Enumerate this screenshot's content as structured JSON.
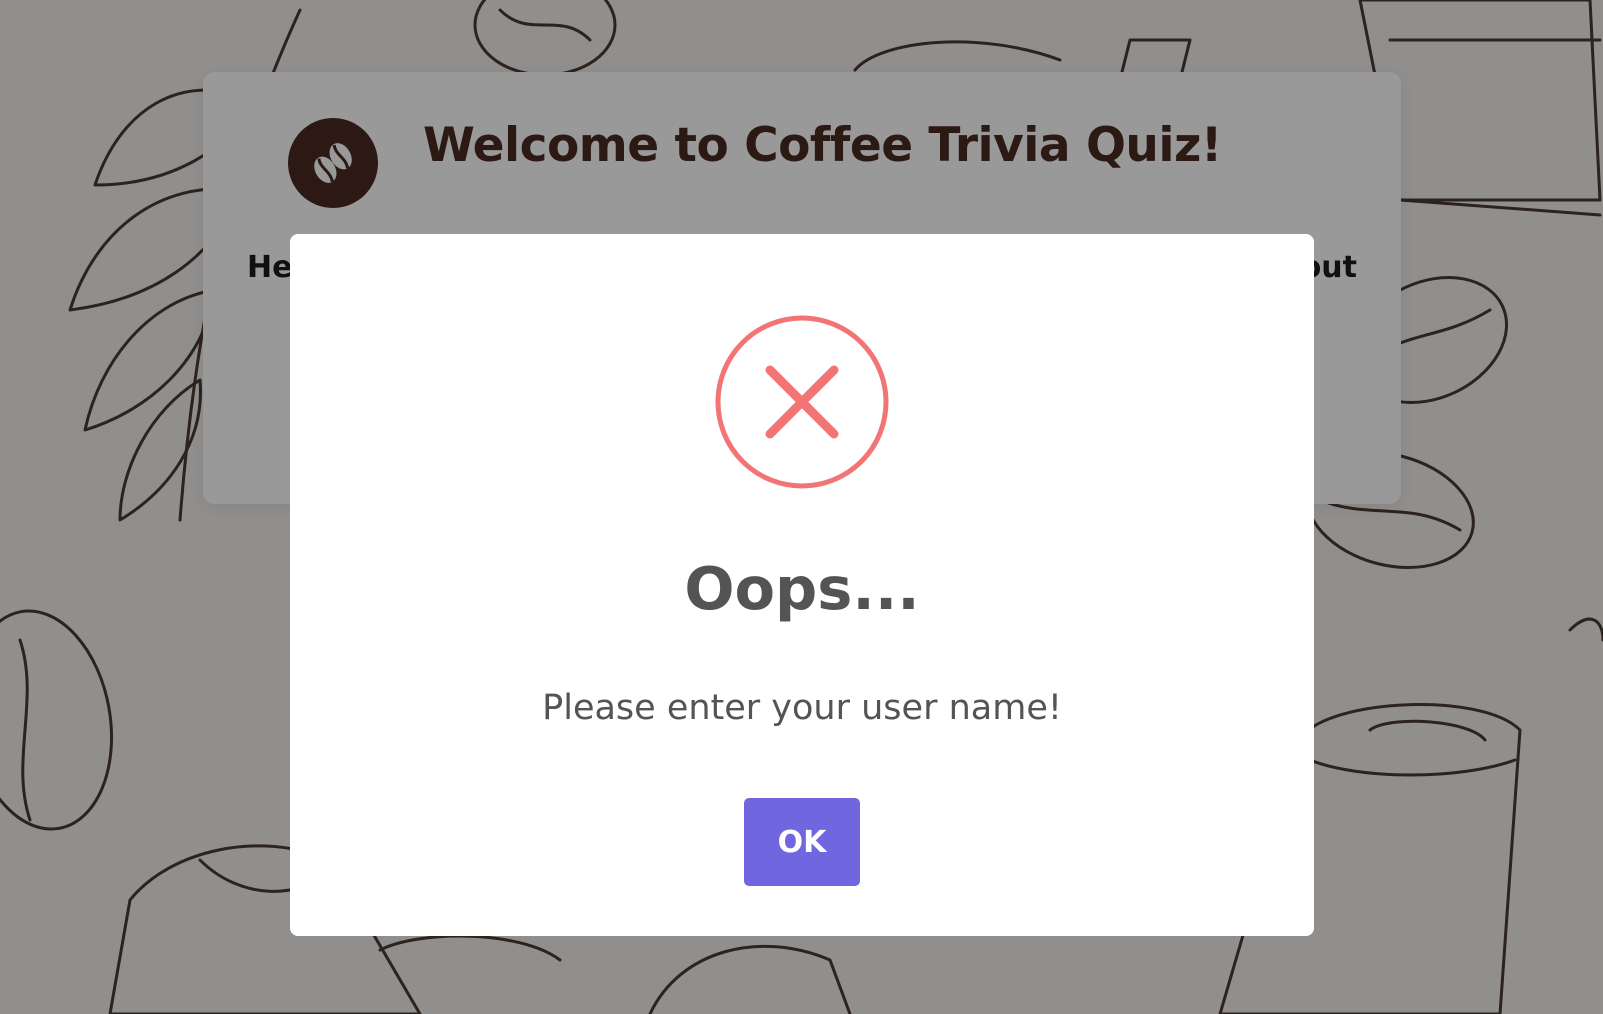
{
  "app": {
    "title": "Welcome to Coffee Trivia Quiz!",
    "logo_icon": "coffee-beans-icon",
    "intro_text_left_visible": "He",
    "intro_text_right_visible": "out"
  },
  "dialog": {
    "icon": "error-x-icon",
    "title": "Oops...",
    "message": "Please enter your user name!",
    "confirm_label": "OK"
  },
  "colors": {
    "brand_brown": "#4a2a22",
    "error_icon": "#f27474",
    "confirm_button": "#7066e0",
    "dialog_text": "#545454"
  }
}
